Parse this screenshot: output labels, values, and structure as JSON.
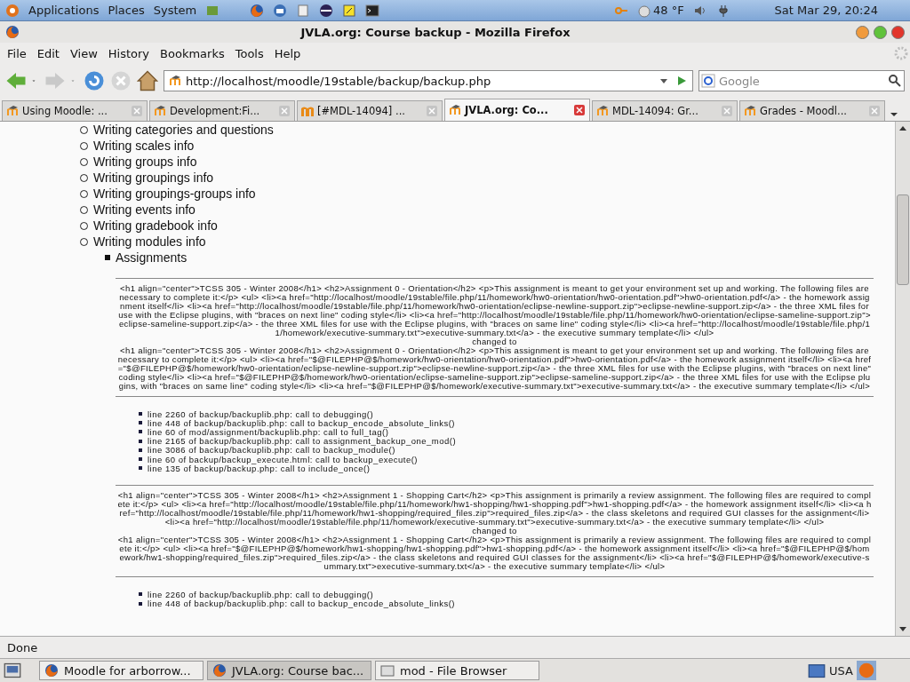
{
  "top_panel": {
    "menus": [
      "Applications",
      "Places",
      "System"
    ],
    "weather": "48 °F",
    "clock": "Sat Mar 29, 20:24"
  },
  "window": {
    "title": "JVLA.org: Course backup - Mozilla Firefox"
  },
  "menu_bar": [
    "File",
    "Edit",
    "View",
    "History",
    "Bookmarks",
    "Tools",
    "Help"
  ],
  "address_bar": {
    "url": "http://localhost/moodle/19stable/backup/backup.php"
  },
  "search": {
    "placeholder": "Google"
  },
  "tabs": [
    {
      "label": "Using Moodle: ...",
      "selected": false,
      "kind": "moodle"
    },
    {
      "label": "Development:Fi...",
      "selected": false,
      "kind": "moodle"
    },
    {
      "label": "[#MDL-14094] ...",
      "selected": false,
      "kind": "tracker"
    },
    {
      "label": "JVLA.org: Co...",
      "selected": true,
      "kind": "moodle"
    },
    {
      "label": "MDL-14094: Gr...",
      "selected": false,
      "kind": "moodle"
    },
    {
      "label": "Grades - Moodl...",
      "selected": false,
      "kind": "moodle"
    }
  ],
  "content": {
    "steps": [
      "Writing categories and questions",
      "Writing scales info",
      "Writing groups info",
      "Writing groupings info",
      "Writing groupings-groups info",
      "Writing events info",
      "Writing gradebook info",
      "Writing modules info"
    ],
    "modules": [
      "Assignments"
    ],
    "debug_blocks": [
      {
        "original": "<h1 align=\"center\">TCSS 305 - Winter 2008</h1> <h2>Assignment 0 - Orientation</h2> <p>This assignment is meant to get your environment set up and working. The following files are necessary to complete it:</p> <ul> <li><a href=\"http://localhost/moodle/19stable/file.php/11/homework/hw0-orientation/hw0-orientation.pdf\">hw0-orientation.pdf</a> - the homework assignment itself</li> <li><a href=\"http://localhost/moodle/19stable/file.php/11/homework/hw0-orientation/eclipse-newline-support.zip\">eclipse-newline-support.zip</a> - the three XML files for use with the Eclipse plugins, with \"braces on next line\" coding style</li> <li><a href=\"http://localhost/moodle/19stable/file.php/11/homework/hw0-orientation/eclipse-sameline-support.zip\">eclipse-sameline-support.zip</a> - the three XML files for use with the Eclipse plugins, with \"braces on same line\" coding style</li> <li><a href=\"http://localhost/moodle/19stable/file.php/11/homework/executive-summary.txt\">executive-summary.txt</a> - the executive summary template</li> </ul>",
        "changed_label": "changed to",
        "changed": "<h1 align=\"center\">TCSS 305 - Winter 2008</h1> <h2>Assignment 0 - Orientation</h2> <p>This assignment is meant to get your environment set up and working. The following files are necessary to complete it:</p> <ul> <li><a href=\"$@FILEPHP@$/homework/hw0-orientation/hw0-orientation.pdf\">hw0-orientation.pdf</a> - the homework assignment itself</li> <li><a href=\"$@FILEPHP@$/homework/hw0-orientation/eclipse-newline-support.zip\">eclipse-newline-support.zip</a> - the three XML files for use with the Eclipse plugins, with \"braces on next line\" coding style</li> <li><a href=\"$@FILEPHP@$/homework/hw0-orientation/eclipse-sameline-support.zip\">eclipse-sameline-support.zip</a> - the three XML files for use with the Eclipse plugins, with \"braces on same line\" coding style</li> <li><a href=\"$@FILEPHP@$/homework/executive-summary.txt\">executive-summary.txt</a> - the executive summary template</li> </ul>",
        "trace": [
          "line 2260 of backup/backuplib.php: call to debugging()",
          "line 448 of backup/backuplib.php: call to backup_encode_absolute_links()",
          "line 60 of mod/assignment/backuplib.php: call to full_tag()",
          "line 2165 of backup/backuplib.php: call to assignment_backup_one_mod()",
          "line 3086 of backup/backuplib.php: call to backup_module()",
          "line 60 of backup/backup_execute.html: call to backup_execute()",
          "line 135 of backup/backup.php: call to include_once()"
        ]
      },
      {
        "original": "<h1 align=\"center\">TCSS 305 - Winter 2008</h1> <h2>Assignment 1 - Shopping Cart</h2> <p>This assignment is primarily a review assignment. The following files are required to complete it:</p> <ul> <li><a href=\"http://localhost/moodle/19stable/file.php/11/homework/hw1-shopping/hw1-shopping.pdf\">hw1-shopping.pdf</a> - the homework assignment itself</li> <li><a href=\"http://localhost/moodle/19stable/file.php/11/homework/hw1-shopping/required_files.zip\">required_files.zip</a> - the class skeletons and required GUI classes for the assignment</li> <li><a href=\"http://localhost/moodle/19stable/file.php/11/homework/executive-summary.txt\">executive-summary.txt</a> - the executive summary template</li> </ul>",
        "changed_label": "changed to",
        "changed": "<h1 align=\"center\">TCSS 305 - Winter 2008</h1> <h2>Assignment 1 - Shopping Cart</h2> <p>This assignment is primarily a review assignment. The following files are required to complete it:</p> <ul> <li><a href=\"$@FILEPHP@$/homework/hw1-shopping/hw1-shopping.pdf\">hw1-shopping.pdf</a> - the homework assignment itself</li> <li><a href=\"$@FILEPHP@$/homework/hw1-shopping/required_files.zip\">required_files.zip</a> - the class skeletons and required GUI classes for the assignment</li> <li><a href=\"$@FILEPHP@$/homework/executive-summary.txt\">executive-summary.txt</a> - the executive summary template</li> </ul>",
        "trace": [
          "line 2260 of backup/backuplib.php: call to debugging()",
          "line 448 of backup/backuplib.php: call to backup_encode_absolute_links()"
        ]
      }
    ]
  },
  "status_bar": {
    "text": "Done"
  },
  "taskbar": {
    "tasks": [
      {
        "label": "Moodle for arborrow...",
        "selected": false,
        "kind": "browser"
      },
      {
        "label": "JVLA.org: Course bac...",
        "selected": true,
        "kind": "browser"
      },
      {
        "label": "mod - File Browser",
        "selected": false,
        "kind": "folder"
      }
    ],
    "keyboard": "USA"
  }
}
